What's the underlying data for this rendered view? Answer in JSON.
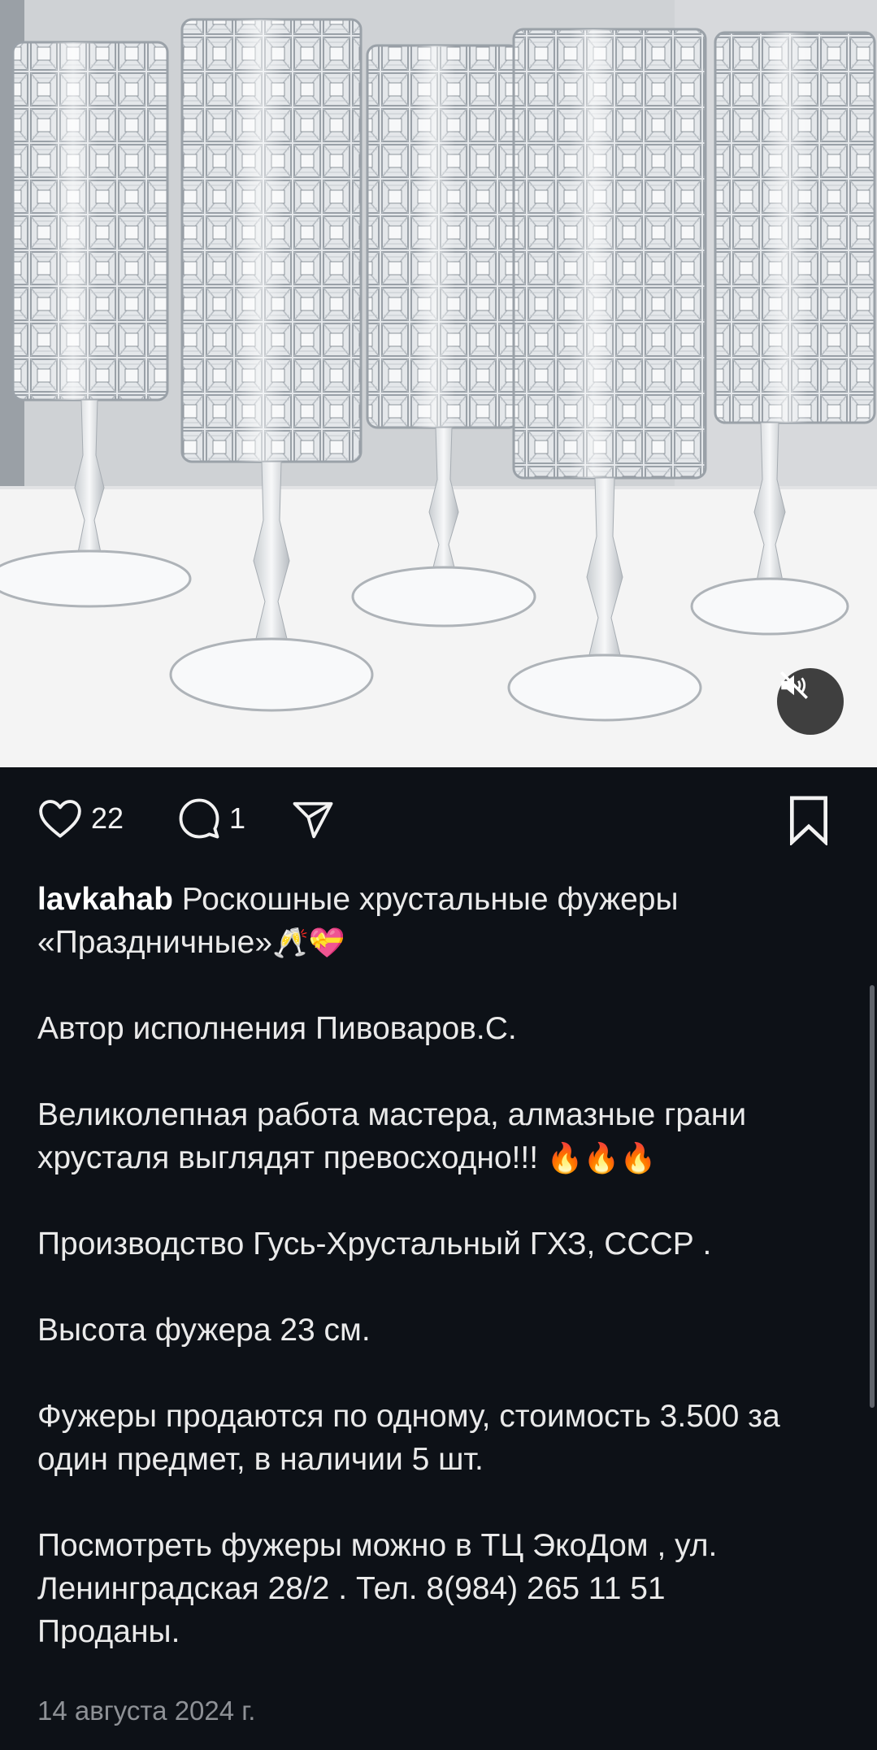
{
  "post": {
    "likes": "22",
    "comments": "1",
    "username": "lavkahab",
    "title_text": "Роскошные хрустальные фужеры «Праздничные»",
    "title_emojis": "🥂💝",
    "line_author": "Автор исполнения Пивоваров.С.",
    "line_quality": "Великолепная работа мастера, алмазные грани хрусталя выглядят превосходно!!!",
    "quality_emojis": "🔥🔥🔥",
    "line_production": "Производство Гусь-Хрустальный ГХЗ, СССР .",
    "line_height": "Высота фужера 23 см.",
    "line_price": "Фужеры продаются по одному, стоимость 3.500 за один предмет, в наличии 5 шт.",
    "line_address": "Посмотреть фужеры можно в ТЦ ЭкоДом , ул. Ленинградская 28/2 . Тел. 8(984) 265 11 51",
    "line_sold": "Проданы.",
    "date": "14 августа 2024 г."
  },
  "icons": {
    "like": "heart-icon",
    "comment": "comment-bubble-icon",
    "share": "paper-plane-icon",
    "save": "bookmark-icon",
    "mute": "speaker-muted-icon"
  },
  "colors": {
    "background": "#0d1117",
    "text": "#eaeaea",
    "muted": "#8e9196"
  }
}
